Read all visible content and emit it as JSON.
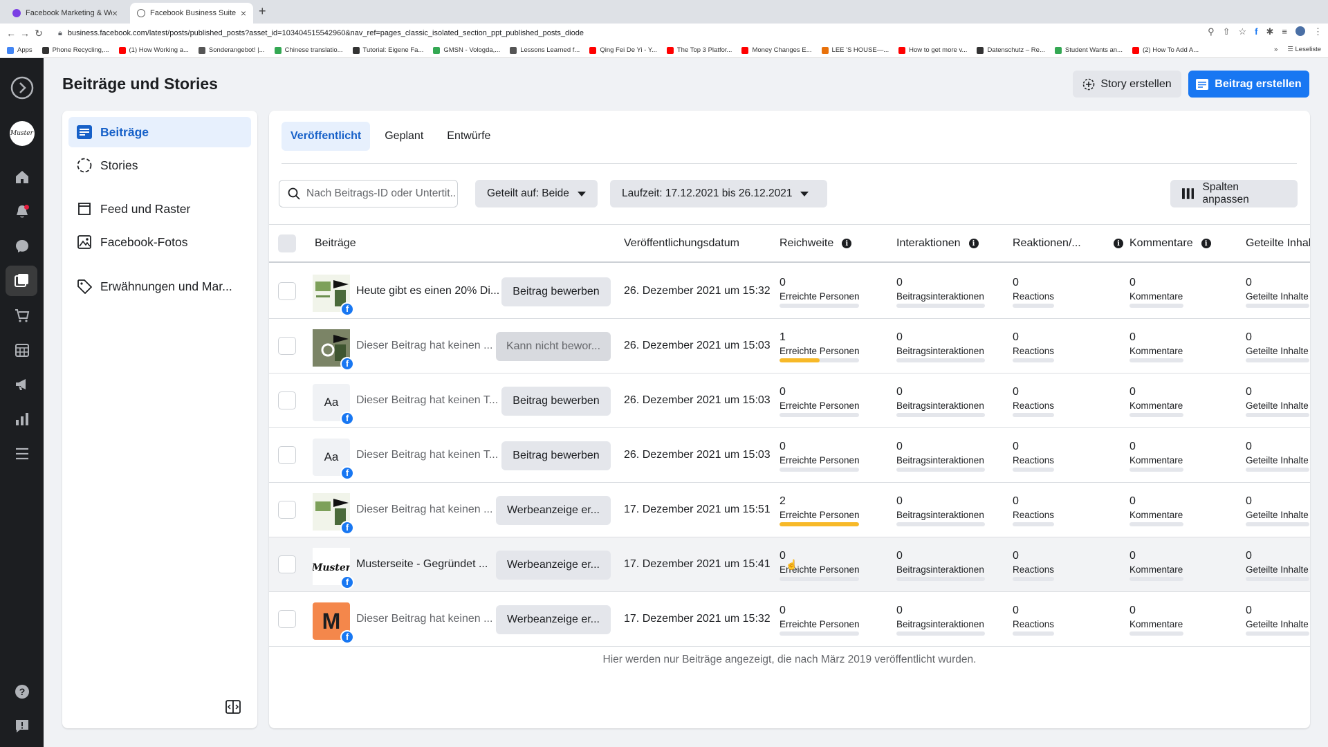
{
  "browser": {
    "tabs": [
      {
        "title": "Facebook Marketing & Werbea...",
        "favicon_color": "#7b3fe4"
      },
      {
        "title": "Facebook Business Suite",
        "favicon_color": "#888888"
      }
    ],
    "new_tab": "+",
    "close": "×",
    "url": "business.facebook.com/latest/posts/published_posts?asset_id=103404515542960&nav_ref=pages_classic_isolated_section_ppt_published_posts_diode",
    "bookmarks": [
      {
        "label": "Apps",
        "color": "#4285f4"
      },
      {
        "label": "Phone Recycling,...",
        "color": "#333333"
      },
      {
        "label": "(1) How Working a...",
        "color": "#ff0000"
      },
      {
        "label": "Sonderangebot! |...",
        "color": "#555555"
      },
      {
        "label": "Chinese translatio...",
        "color": "#34a853"
      },
      {
        "label": "Tutorial: Eigene Fa...",
        "color": "#333333"
      },
      {
        "label": "GMSN - Vologda,...",
        "color": "#34a853"
      },
      {
        "label": "Lessons Learned f...",
        "color": "#555555"
      },
      {
        "label": "Qing Fei De Yi - Y...",
        "color": "#ff0000"
      },
      {
        "label": "The Top 3 Platfor...",
        "color": "#ff0000"
      },
      {
        "label": "Money Changes E...",
        "color": "#ff0000"
      },
      {
        "label": "LEE 'S HOUSE—...",
        "color": "#e8710a"
      },
      {
        "label": "How to get more v...",
        "color": "#ff0000"
      },
      {
        "label": "Datenschutz – Re...",
        "color": "#333333"
      },
      {
        "label": "Student Wants an...",
        "color": "#34a853"
      },
      {
        "label": "(2) How To Add A...",
        "color": "#ff0000"
      }
    ],
    "bookmarks_more": "»",
    "reading_list": "Leseliste"
  },
  "header": {
    "title": "Beiträge und Stories",
    "story_button": "Story erstellen",
    "post_button": "Beitrag erstellen"
  },
  "sidebar": {
    "items": [
      {
        "label": "Beiträge",
        "icon": "posts-icon"
      },
      {
        "label": "Stories",
        "icon": "stories-icon"
      },
      {
        "label": "Feed und Raster",
        "icon": "feed-icon"
      },
      {
        "label": "Facebook-Fotos",
        "icon": "photos-icon"
      },
      {
        "label": "Erwähnungen und Mar...",
        "icon": "tag-icon"
      }
    ]
  },
  "main": {
    "tabs": [
      "Veröffentlicht",
      "Geplant",
      "Entwürfe"
    ],
    "search_placeholder": "Nach Beitrags-ID oder Untertit...",
    "filter_shared": "Geteilt auf: Beide",
    "filter_range": "Laufzeit: 17.12.2021 bis 26.12.2021",
    "columns_button": "Spalten anpassen",
    "columns": [
      "Beiträge",
      "Veröffentlichungsdatum",
      "Reichweite",
      "Interaktionen",
      "Reaktionen/...",
      "Kommentare",
      "Geteilte Inhal"
    ],
    "metric_labels": [
      "Erreichte Personen",
      "Beitragsinteraktionen",
      "Reactions",
      "Kommentare",
      "Geteilte Inhalte"
    ],
    "rows": [
      {
        "title": "Heute gibt es einen 20% Di...",
        "button": "Beitrag bewerben",
        "date": "26. Dezember 2021 um 15:32",
        "reach": "0",
        "interactions": "0",
        "reactions": "0",
        "comments": "0",
        "shares": "0",
        "reach_fraction": 0
      },
      {
        "title": "Dieser Beitrag hat keinen ...",
        "button": "Kann nicht bewor...",
        "date": "26. Dezember 2021 um 15:03",
        "reach": "1",
        "interactions": "0",
        "reactions": "0",
        "comments": "0",
        "shares": "0",
        "reach_fraction": 0.5
      },
      {
        "title": "Dieser Beitrag hat keinen T...",
        "button": "Beitrag bewerben",
        "date": "26. Dezember 2021 um 15:03",
        "reach": "0",
        "interactions": "0",
        "reactions": "0",
        "comments": "0",
        "shares": "0",
        "reach_fraction": 0,
        "thumb_text": "Aa"
      },
      {
        "title": "Dieser Beitrag hat keinen T...",
        "button": "Beitrag bewerben",
        "date": "26. Dezember 2021 um 15:03",
        "reach": "0",
        "interactions": "0",
        "reactions": "0",
        "comments": "0",
        "shares": "0",
        "reach_fraction": 0,
        "thumb_text": "Aa"
      },
      {
        "title": "Dieser Beitrag hat keinen ...",
        "button": "Werbeanzeige er...",
        "date": "17. Dezember 2021 um 15:51",
        "reach": "2",
        "interactions": "0",
        "reactions": "0",
        "comments": "0",
        "shares": "0",
        "reach_fraction": 1
      },
      {
        "title": "Musterseite - Gegründet ...",
        "button": "Werbeanzeige er...",
        "date": "17. Dezember 2021 um 15:41",
        "reach": "0",
        "interactions": "0",
        "reactions": "0",
        "comments": "0",
        "shares": "0",
        "reach_fraction": 0
      },
      {
        "title": "Dieser Beitrag hat keinen ...",
        "button": "Werbeanzeige er...",
        "date": "17. Dezember 2021 um 15:32",
        "reach": "0",
        "interactions": "0",
        "reactions": "0",
        "comments": "0",
        "shares": "0",
        "reach_fraction": 0,
        "thumb_text": "M"
      }
    ],
    "footnote": "Hier werden nur Beiträge angezeigt, die nach März 2019 veröffentlicht wurden."
  },
  "colors": {
    "accent": "#1877f2",
    "reach_bar": "#f7b928",
    "nav_bg": "#1c1e21"
  }
}
